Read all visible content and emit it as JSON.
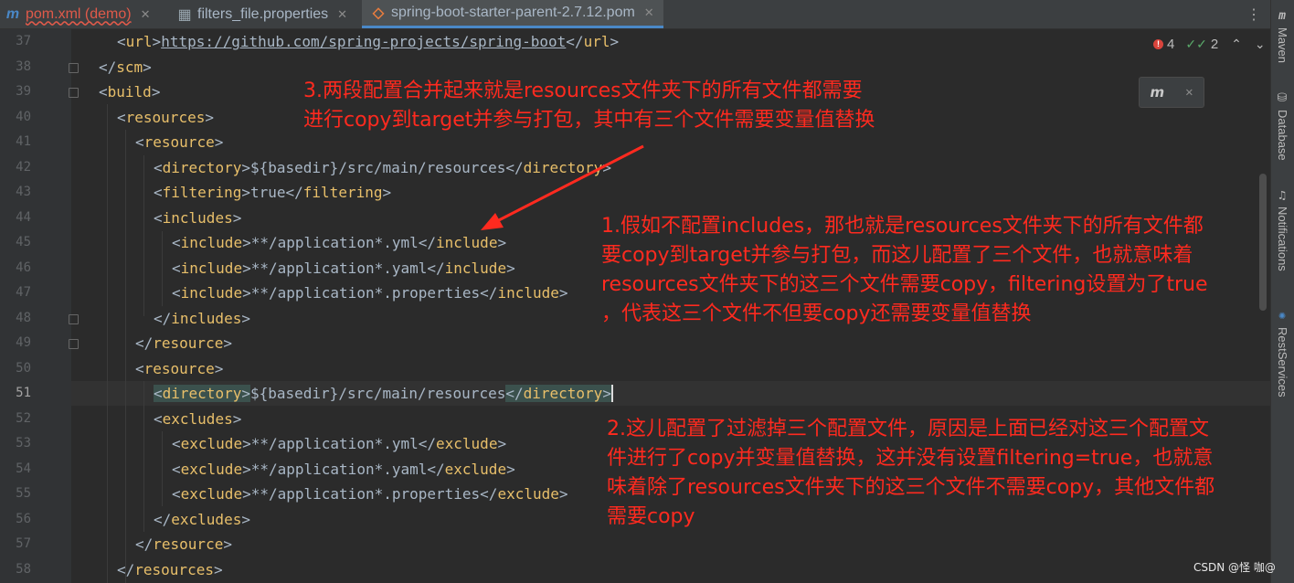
{
  "tabs": [
    {
      "icon": "m",
      "label": "pom.xml (demo)",
      "close": "✕"
    },
    {
      "icon": "▦",
      "label": "filters_file.properties",
      "close": "✕"
    },
    {
      "icon": "◇",
      "label": "spring-boot-starter-parent-2.7.12.pom",
      "close": "✕"
    }
  ],
  "tab_more": "⋮",
  "line_numbers": [
    "37",
    "38",
    "39",
    "40",
    "41",
    "42",
    "43",
    "44",
    "45",
    "46",
    "47",
    "48",
    "49",
    "50",
    "51",
    "52",
    "53",
    "54",
    "55",
    "56",
    "57",
    "58"
  ],
  "code": {
    "l37": {
      "open": "url",
      "url": "https://github.com/spring-projects/spring-boot",
      "close": "url"
    },
    "l38": {
      "close": "scm"
    },
    "l39": {
      "open": "build"
    },
    "l40": {
      "open": "resources"
    },
    "l41": {
      "open": "resource"
    },
    "l42": {
      "open": "directory",
      "text": "${basedir}/src/main/resources",
      "close": "directory"
    },
    "l43": {
      "open": "filtering",
      "text": "true",
      "close": "filtering"
    },
    "l44": {
      "open": "includes"
    },
    "l45": {
      "open": "include",
      "text": "**/application*.yml",
      "close": "include"
    },
    "l46": {
      "open": "include",
      "text": "**/application*.yaml",
      "close": "include"
    },
    "l47": {
      "open": "include",
      "text": "**/application*.properties",
      "close": "include"
    },
    "l48": {
      "close": "includes"
    },
    "l49": {
      "close": "resource"
    },
    "l50": {
      "open": "resource"
    },
    "l51": {
      "open": "directory",
      "text": "${basedir}/src/main/resources",
      "close": "directory"
    },
    "l52": {
      "open": "excludes"
    },
    "l53": {
      "open": "exclude",
      "text": "**/application*.yml",
      "close": "exclude"
    },
    "l54": {
      "open": "exclude",
      "text": "**/application*.yaml",
      "close": "exclude"
    },
    "l55": {
      "open": "exclude",
      "text": "**/application*.properties",
      "close": "exclude"
    },
    "l56": {
      "close": "excludes"
    },
    "l57": {
      "close": "resource"
    },
    "l58": {
      "close": "resources"
    }
  },
  "inspections": {
    "errors": "4",
    "warnings": "2",
    "up": "⌃",
    "down": "⌄",
    "error_mark": "!",
    "ok_mark": "✓✓"
  },
  "maven_popup": {
    "icon_text": "m",
    "close": "✕"
  },
  "right_panel": {
    "maven": "Maven",
    "database": "Database",
    "notifications": "Notifications",
    "rest": "RestServices"
  },
  "annotations": {
    "a3": "3.两段配置合并起来就是resources文件夹下的所有文件都需要\n进行copy到target并参与打包，其中有三个文件需要变量值替换",
    "a1": "1.假如不配置includes，那也就是resources文件夹下的所有文件都\n要copy到target并参与打包，而这儿配置了三个文件，也就意味着\nresources文件夹下的这三个文件需要copy，filtering设置为了true\n，代表这三个文件不但要copy还需要变量值替换",
    "a2": "2.这儿配置了过滤掉三个配置文件，原因是上面已经对这三个配置文\n件进行了copy并变量值替换，这并没有设置filtering=true，也就意\n味着除了resources文件夹下的这三个文件不需要copy，其他文件都\n需要copy"
  },
  "watermark": "CSDN @怪 咖@",
  "colors": {
    "tag": "#e8bf6a",
    "annotation": "#ff2a1f",
    "background": "#2b2b2b"
  }
}
